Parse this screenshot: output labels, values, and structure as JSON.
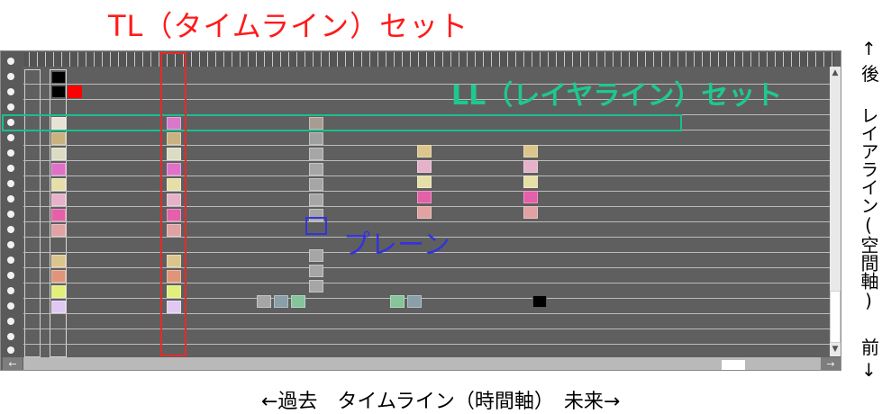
{
  "title": "TL（タイムライン）セット",
  "ll_label": "LL（レイヤライン）セット",
  "plane_label": "プレーン",
  "side": {
    "top": "↑後",
    "middle": "レイアライン(空間軸)",
    "bottom": "前↓"
  },
  "bottom_caption": "←過去　タイムライン（時間軸）　未来→",
  "scroll": {
    "left_arrow": "←",
    "right_arrow": "→",
    "up_arrow": "▲",
    "down_arrow": "▼"
  },
  "colors": {
    "tl_outline": "#e32b2b",
    "ll_outline": "#17c08f",
    "plane_outline": "#3333dd",
    "panel_bg": "#5f5f5f"
  }
}
